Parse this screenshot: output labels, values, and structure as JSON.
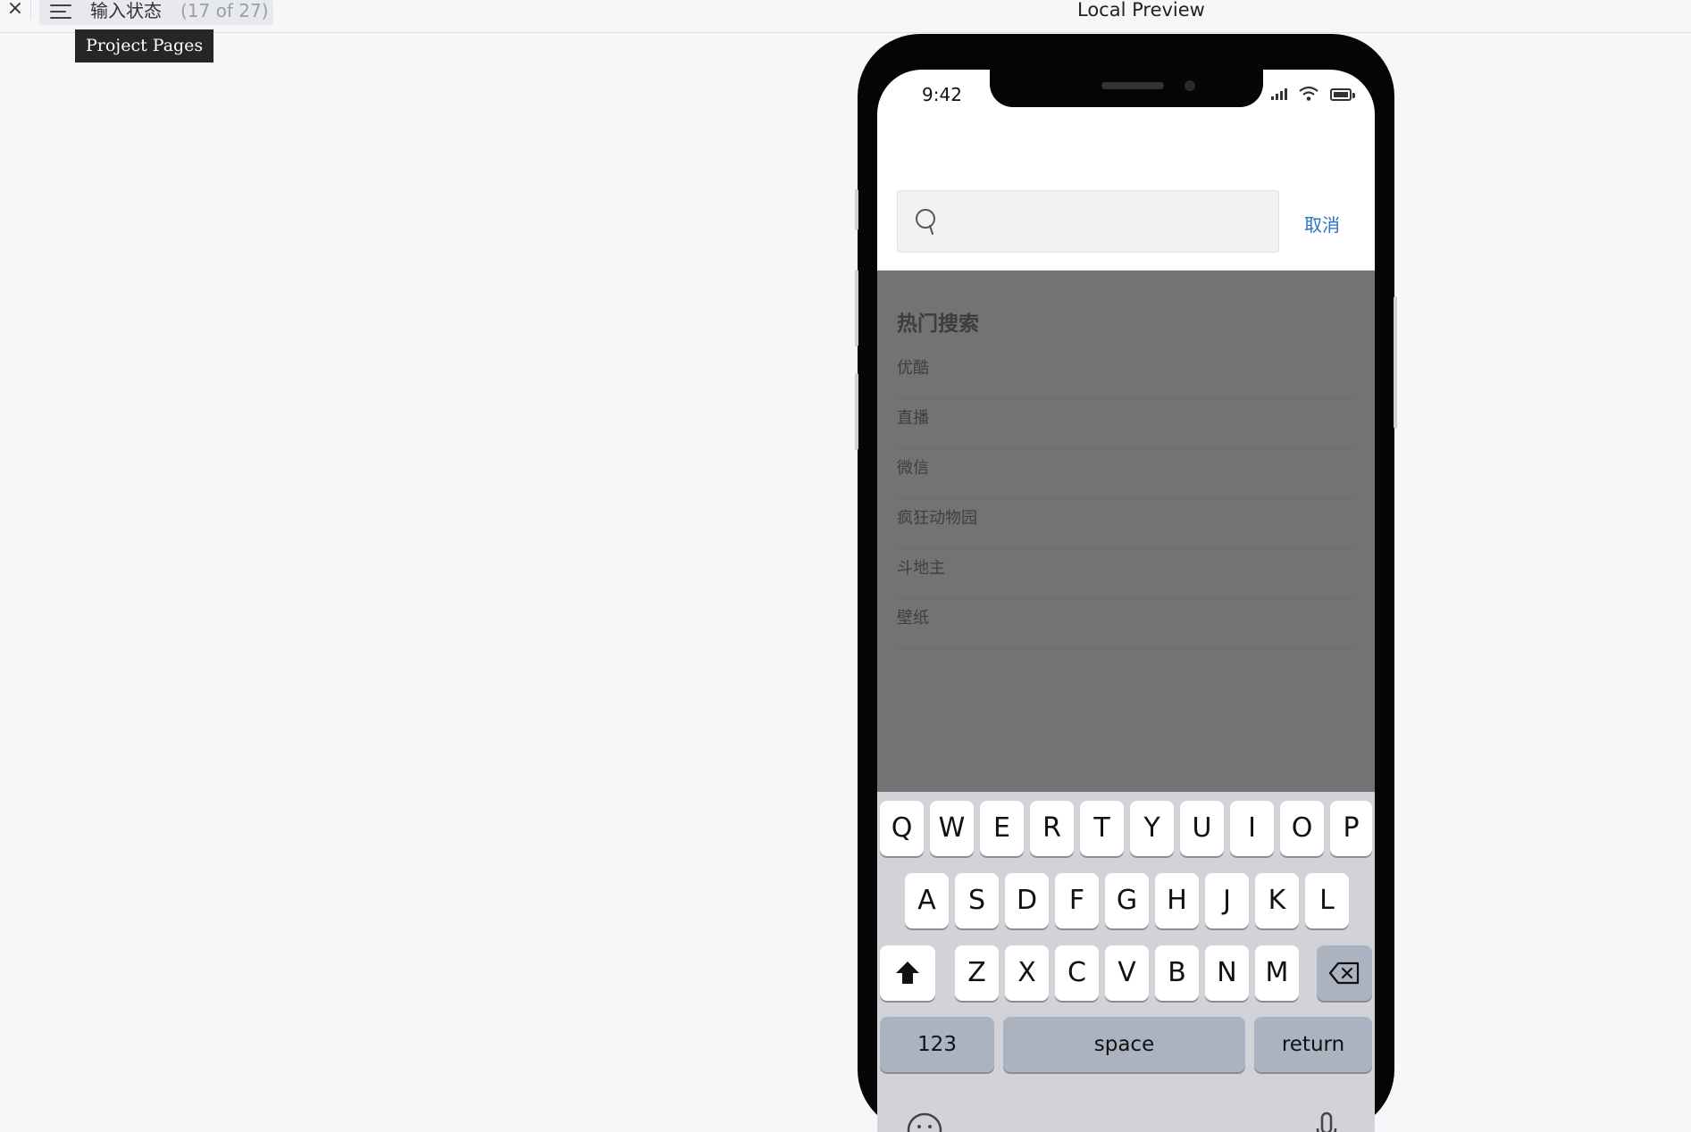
{
  "toolbar": {
    "close_glyph": "×",
    "page_name": "输入状态",
    "page_count": "(17 of 27)",
    "tooltip": "Project Pages",
    "preview_title": "Local Preview"
  },
  "status_bar": {
    "time": "9:42"
  },
  "search": {
    "placeholder": "",
    "value": "",
    "cancel_label": "取消"
  },
  "hot_search": {
    "title": "热门搜索",
    "items": [
      "优酷",
      "直播",
      "微信",
      "疯狂动物园",
      "斗地主",
      "壁纸"
    ]
  },
  "keyboard": {
    "row1": [
      "Q",
      "W",
      "E",
      "R",
      "T",
      "Y",
      "U",
      "I",
      "O",
      "P"
    ],
    "row2": [
      "A",
      "S",
      "D",
      "F",
      "G",
      "H",
      "J",
      "K",
      "L"
    ],
    "row3": [
      "Z",
      "X",
      "C",
      "V",
      "B",
      "N",
      "M"
    ],
    "numbers_label": "123",
    "space_label": "space",
    "return_label": "return",
    "shift_icon": "shift-icon",
    "delete_icon": "backspace-icon"
  },
  "colors": {
    "accent_link": "#2a72c4",
    "overlay": "#737373",
    "keyboard_bg": "#d1d3d9",
    "function_key": "#abb3c1"
  }
}
